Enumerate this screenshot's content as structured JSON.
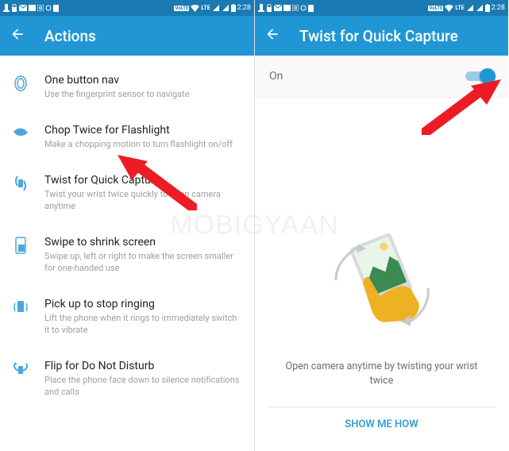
{
  "status": {
    "time": "2:28",
    "lte": "LTE",
    "volte": "VoLTE"
  },
  "left": {
    "title": "Actions",
    "items": [
      {
        "title": "One button nav",
        "desc": "Use the fingerprint sensor to navigate"
      },
      {
        "title": "Chop Twice for Flashlight",
        "desc": "Make a chopping motion to turn flashlight on/off"
      },
      {
        "title": "Twist for Quick Capture",
        "desc": "Twist your wrist twice quickly to open camera anytime"
      },
      {
        "title": "Swipe to shrink screen",
        "desc": "Swipe up, left or right to make the screen smaller for one-handed use"
      },
      {
        "title": "Pick up to stop ringing",
        "desc": "Lift the phone when it rings to immediately switch it to vibrate"
      },
      {
        "title": "Flip for Do Not Disturb",
        "desc": "Place the phone face down to silence notifications and calls"
      }
    ]
  },
  "right": {
    "title": "Twist for Quick Capture",
    "toggle_label": "On",
    "toggle_state": true,
    "hero_text": "Open camera anytime by twisting your wrist twice",
    "show_me": "SHOW ME HOW"
  },
  "watermark": "MOBIGYAAN",
  "colors": {
    "primary": "#2196d5",
    "status": "#1a7ab4",
    "accent_yellow": "#eeb123"
  }
}
